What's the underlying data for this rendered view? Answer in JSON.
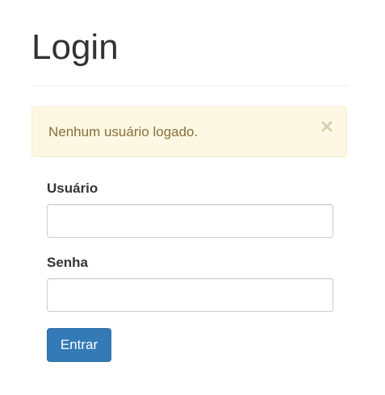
{
  "page": {
    "title": "Login"
  },
  "alert": {
    "message": "Nenhum usuário logado.",
    "close_icon": "close-icon",
    "colors": {
      "background": "#fcf8e3",
      "border": "#faebcc",
      "text": "#8a6d3b"
    }
  },
  "form": {
    "username": {
      "label": "Usuário",
      "value": "",
      "placeholder": ""
    },
    "password": {
      "label": "Senha",
      "value": "",
      "placeholder": ""
    },
    "submit_label": "Entrar"
  },
  "colors": {
    "primary_button": "#337ab7"
  }
}
